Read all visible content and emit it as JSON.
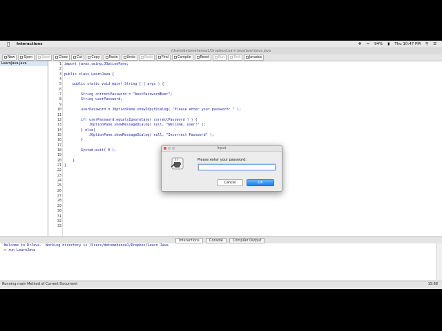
{
  "menubar": {
    "app_name": "Interactions",
    "battery": "94%",
    "clock": "Thu 10:47 PM"
  },
  "window": {
    "title": "/Users/detomehenoa1/Dropbox/Learn Java/LearnJava.java"
  },
  "toolbar": {
    "buttons": [
      {
        "label": "New",
        "enabled": true
      },
      {
        "label": "Open",
        "enabled": true
      },
      {
        "label": "Save",
        "enabled": false
      },
      {
        "label": "Close",
        "enabled": true
      },
      {
        "label": "Cut",
        "enabled": true
      },
      {
        "label": "Copy",
        "enabled": true
      },
      {
        "label": "Paste",
        "enabled": true
      },
      {
        "label": "Undo",
        "enabled": true
      },
      {
        "label": "Redo",
        "enabled": false
      },
      {
        "label": "Find",
        "enabled": true
      },
      {
        "label": "Compile",
        "enabled": true
      },
      {
        "label": "Reset",
        "enabled": true
      },
      {
        "label": "Run",
        "enabled": false
      },
      {
        "label": "Test",
        "enabled": false
      },
      {
        "label": "Javadoc",
        "enabled": true
      }
    ]
  },
  "files": [
    "LearnJava.java"
  ],
  "editor": {
    "lines": [
      "import javax.swing.JOptionPane;",
      "",
      "public class LearnJava {",
      "",
      "    public static void main( String [ ] args ) {",
      "",
      "        String correctPassword = \"bestPasswordEver\";",
      "        String userPassword;",
      "",
      "        userPassword = JOptionPane.showInputDialog( \"Please enter your password: \" );",
      "",
      "        if( userPassword.equalsIgnoreCase( correctPassword ) ) {",
      "            JOptionPane.showMessageDialog( null, \"Welcome, user!\" );",
      "        } else{",
      "            JOptionPane.showMessageDialog( null, \"Incorrect Password\" );",
      "        }",
      "",
      "        System.exit( 0 );",
      "",
      "    }",
      "}",
      "",
      "",
      "",
      "",
      "",
      "",
      "",
      "",
      "",
      "",
      "",
      ""
    ]
  },
  "pane_tabs": {
    "interactions": "Interactions",
    "console": "Console",
    "compiler": "Compiler Output"
  },
  "interactions_pane": {
    "lines": [
      "Welcome to DrJava.  Working directory is /Users/detomehenoa1/Dropbox/Learn Java",
      "> run LearnJava"
    ]
  },
  "statusbar": {
    "message": "Running main Method of Current Document",
    "position": "15:68"
  },
  "dialog": {
    "title": "Input",
    "prompt": "Please enter your password:",
    "input_value": "",
    "cancel_label": "Cancel",
    "ok_label": "OK"
  }
}
